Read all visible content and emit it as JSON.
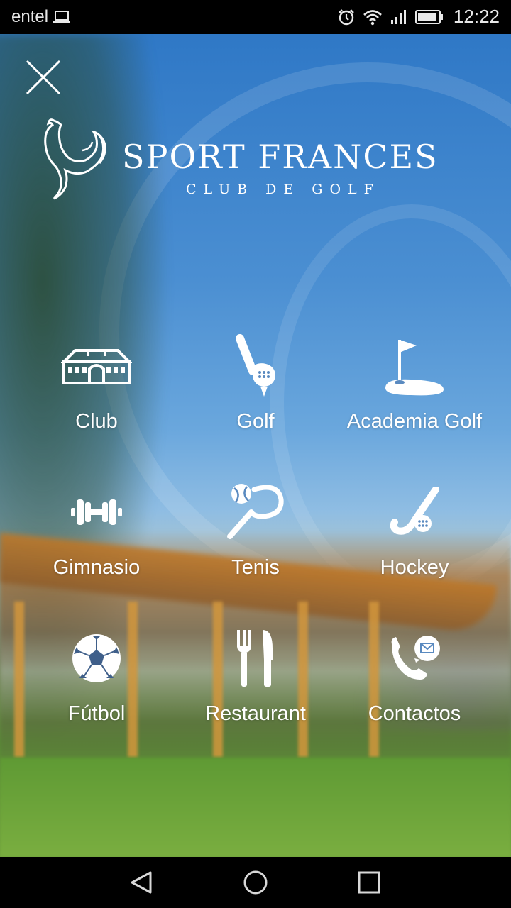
{
  "status_bar": {
    "carrier": "entel",
    "time": "12:22",
    "icons": [
      "laptop-icon",
      "alarm-icon",
      "wifi-icon",
      "signal-icon",
      "battery-icon"
    ]
  },
  "app": {
    "logo_title": "SPORT FRANCES",
    "logo_subtitle": "CLUB DE GOLF",
    "close_icon": "close-icon"
  },
  "menu": {
    "items": [
      {
        "label": "Club",
        "icon": "clubhouse-icon"
      },
      {
        "label": "Golf",
        "icon": "golf-club-ball-icon"
      },
      {
        "label": "Academia Golf",
        "icon": "golf-flag-icon"
      },
      {
        "label": "Gimnasio",
        "icon": "dumbbell-icon"
      },
      {
        "label": "Tenis",
        "icon": "tennis-racket-icon"
      },
      {
        "label": "Hockey",
        "icon": "hockey-stick-icon"
      },
      {
        "label": "Fútbol",
        "icon": "soccer-ball-icon"
      },
      {
        "label": "Restaurant",
        "icon": "fork-knife-icon"
      },
      {
        "label": "Contactos",
        "icon": "phone-mail-icon"
      }
    ]
  },
  "nav_bar": {
    "back": "back-icon",
    "home": "home-icon",
    "recents": "recents-icon"
  }
}
